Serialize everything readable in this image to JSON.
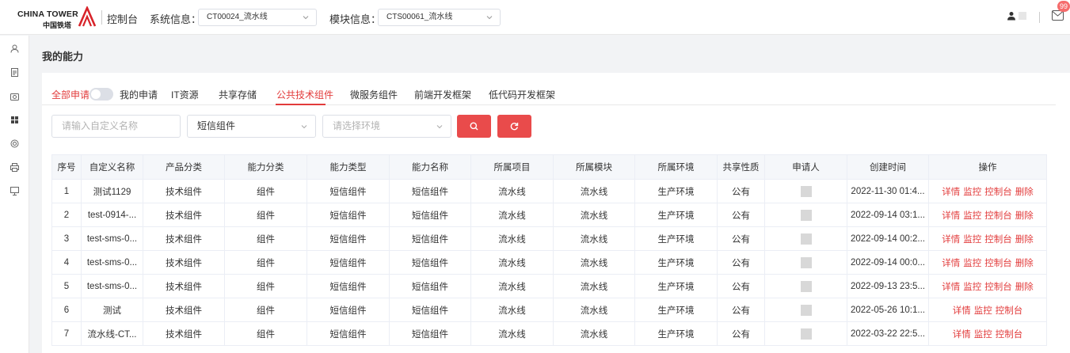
{
  "header": {
    "logo_en": "CHINA TOWER",
    "logo_cn": "中国铁塔",
    "console": "控制台",
    "system_label": "系统信息：",
    "system_value": "CT00024_流水线",
    "module_label": "模块信息：",
    "module_value": "CTS00061_流水线",
    "mail_badge": "99"
  },
  "sidebar": {
    "icons": [
      "user-icon",
      "document-icon",
      "camera-icon",
      "grid-icon",
      "circle-icon",
      "printer-icon",
      "monitor-icon"
    ]
  },
  "page": {
    "title": "我的能力"
  },
  "tabs": {
    "all_apply": "全部申请",
    "my_apply": "我的申请",
    "items": [
      "IT资源",
      "共享存储",
      "公共技术组件",
      "微服务组件",
      "前端开发框架",
      "低代码开发框架"
    ],
    "active": "公共技术组件"
  },
  "filters": {
    "name_placeholder": "请输入自定义名称",
    "type_value": "短信组件",
    "env_placeholder": "请选择环境"
  },
  "table": {
    "headers": [
      "序号",
      "自定义名称",
      "产品分类",
      "能力分类",
      "能力类型",
      "能力名称",
      "所属项目",
      "所属模块",
      "所属环境",
      "共享性质",
      "申请人",
      "创建时间",
      "操作"
    ],
    "rows": [
      {
        "no": "1",
        "name": "测试1129",
        "product": "技术组件",
        "cap_cat": "组件",
        "cap_type": "短信组件",
        "cap_name": "短信组件",
        "project": "流水线",
        "module": "流水线",
        "env": "生产环境",
        "share": "公有",
        "created": "2022-11-30 01:4...",
        "ops": [
          "详情",
          "监控",
          "控制台",
          "删除"
        ]
      },
      {
        "no": "2",
        "name": "test-0914-...",
        "product": "技术组件",
        "cap_cat": "组件",
        "cap_type": "短信组件",
        "cap_name": "短信组件",
        "project": "流水线",
        "module": "流水线",
        "env": "生产环境",
        "share": "公有",
        "created": "2022-09-14 03:1...",
        "ops": [
          "详情",
          "监控",
          "控制台",
          "删除"
        ]
      },
      {
        "no": "3",
        "name": "test-sms-0...",
        "product": "技术组件",
        "cap_cat": "组件",
        "cap_type": "短信组件",
        "cap_name": "短信组件",
        "project": "流水线",
        "module": "流水线",
        "env": "生产环境",
        "share": "公有",
        "created": "2022-09-14 00:2...",
        "ops": [
          "详情",
          "监控",
          "控制台",
          "删除"
        ]
      },
      {
        "no": "4",
        "name": "test-sms-0...",
        "product": "技术组件",
        "cap_cat": "组件",
        "cap_type": "短信组件",
        "cap_name": "短信组件",
        "project": "流水线",
        "module": "流水线",
        "env": "生产环境",
        "share": "公有",
        "created": "2022-09-14 00:0...",
        "ops": [
          "详情",
          "监控",
          "控制台",
          "删除"
        ]
      },
      {
        "no": "5",
        "name": "test-sms-0...",
        "product": "技术组件",
        "cap_cat": "组件",
        "cap_type": "短信组件",
        "cap_name": "短信组件",
        "project": "流水线",
        "module": "流水线",
        "env": "生产环境",
        "share": "公有",
        "created": "2022-09-13 23:5...",
        "ops": [
          "详情",
          "监控",
          "控制台",
          "删除"
        ]
      },
      {
        "no": "6",
        "name": "测试",
        "product": "技术组件",
        "cap_cat": "组件",
        "cap_type": "短信组件",
        "cap_name": "短信组件",
        "project": "流水线",
        "module": "流水线",
        "env": "生产环境",
        "share": "公有",
        "created": "2022-05-26 10:1...",
        "ops": [
          "详情",
          "监控",
          "控制台"
        ]
      },
      {
        "no": "7",
        "name": "流水线-CT...",
        "product": "技术组件",
        "cap_cat": "组件",
        "cap_type": "短信组件",
        "cap_name": "短信组件",
        "project": "流水线",
        "module": "流水线",
        "env": "生产环境",
        "share": "公有",
        "created": "2022-03-22 22:5...",
        "ops": [
          "详情",
          "监控",
          "控制台"
        ]
      }
    ]
  },
  "colors": {
    "accent": "#e23b3b",
    "button": "#e94b4b",
    "header_bg": "#f5f7fa"
  }
}
